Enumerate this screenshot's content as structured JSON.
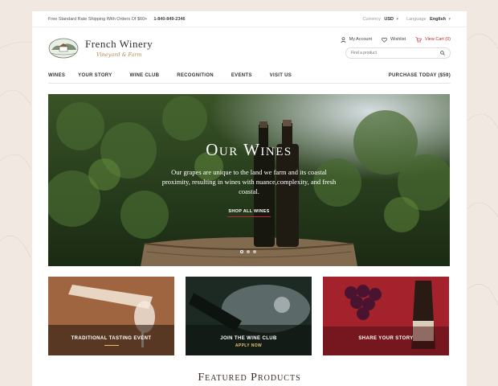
{
  "topbar": {
    "promo": "Free Standard Rate Shipping With Orders Of $60+",
    "phone": "1-840-849-2346",
    "currency_label": "Currency",
    "currency_value": "USD",
    "language_label": "Language",
    "language_value": "English"
  },
  "header": {
    "logo_name": "French Winery",
    "logo_tagline": "Vineyard & Farm",
    "my_account": "My Account",
    "wishlist": "Wishlist",
    "view_cart": "View Cart (0)",
    "search_placeholder": "Find a product"
  },
  "nav": {
    "items": [
      "WINES",
      "YOUR STORY",
      "WINE CLUB",
      "RECOGNITION",
      "EVENTS",
      "VISIT US"
    ],
    "purchase": "PURCHASE TODAY ($59)"
  },
  "hero": {
    "title": "Our Wines",
    "description": "Our grapes are unique to the land we farm and its coastal proximity, resulting in wines with nuance,complexity, and fresh coastal.",
    "button": "SHOP ALL WINES",
    "slide_count": 3,
    "active_slide": 1
  },
  "promos": [
    {
      "label": "TRADITIONAL TASTING EVENT",
      "sub": ""
    },
    {
      "label": "JOIN THE WINE CLUB",
      "sub": "APPLY NOW"
    },
    {
      "label": "SHARE YOUR STORY",
      "sub": ""
    }
  ],
  "featured": {
    "title": "Featured Products"
  },
  "colors": {
    "accent": "#c0262f",
    "gold": "#b08a4e",
    "page_bg": "#f1e9e1"
  }
}
